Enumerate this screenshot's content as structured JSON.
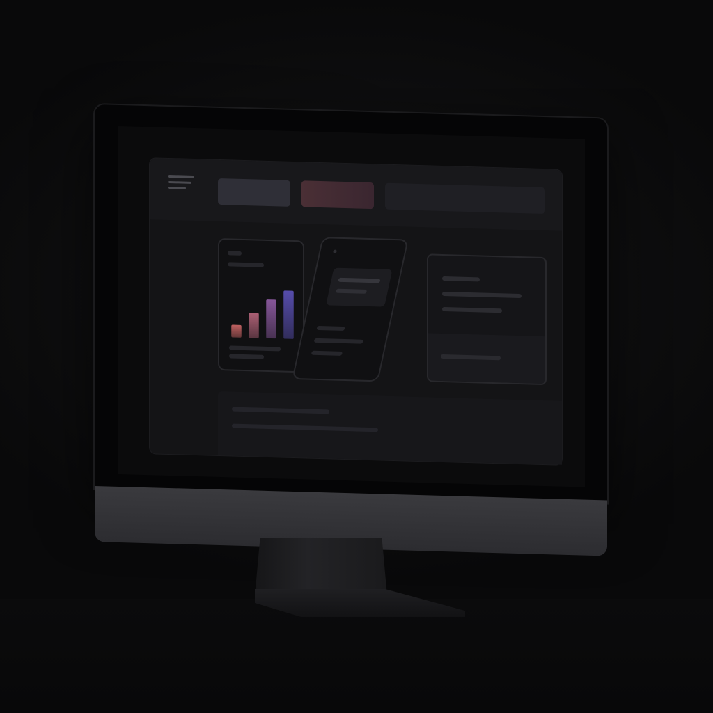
{
  "colors": {
    "background": "#0d0d0e",
    "bezel": "#050506",
    "chin": "#333337",
    "screen": "#0b0b0c",
    "app_window": "#141416",
    "topbar": "#18181b",
    "accent_pill": "#4a2f35"
  },
  "app": {
    "topbar": {
      "menu_icon": "hamburger-menu-icon",
      "pills": [
        "",
        "",
        ""
      ]
    },
    "chart_card": {
      "chart_data": {
        "type": "bar",
        "categories": [
          "",
          "",
          "",
          ""
        ],
        "values": [
          20,
          40,
          62,
          77
        ],
        "ylim": [
          0,
          100
        ],
        "bar_colors": [
          "#c86464",
          "#b4647a",
          "#8c5aa0",
          "#5a50b4"
        ],
        "grid": false,
        "legend": "none"
      }
    },
    "phone_card": {},
    "panel_card": {},
    "bottom_card": {}
  }
}
